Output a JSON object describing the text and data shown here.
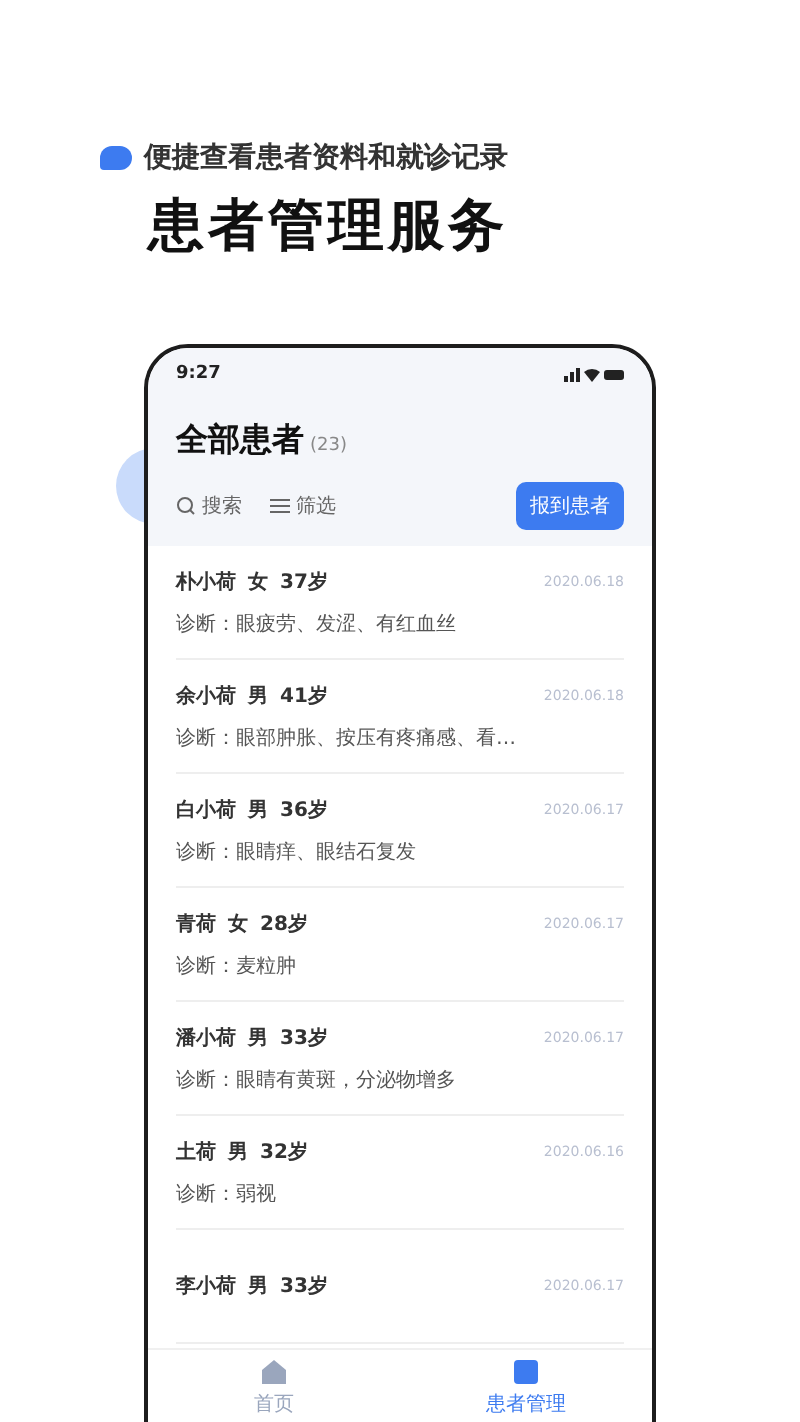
{
  "headline": {
    "subtitle": "便捷查看患者资料和就诊记录",
    "title": "患者管理服务"
  },
  "phone": {
    "status_bar": {
      "time": "9:27"
    },
    "header": {
      "title": "全部患者",
      "count": "(23)",
      "search": "搜索",
      "filter": "筛选",
      "button": "报到患者"
    },
    "patients": [
      {
        "name": "朴小荷",
        "gender": "女",
        "age": "37岁",
        "date": "2020.06.18",
        "diagnosis": "诊断：眼疲劳、发涩、有红血丝"
      },
      {
        "name": "余小荷",
        "gender": "男",
        "age": "41岁",
        "date": "2020.06.18",
        "diagnosis": "诊断：眼部肿胀、按压有疼痛感、看…"
      },
      {
        "name": "白小荷",
        "gender": "男",
        "age": "36岁",
        "date": "2020.06.17",
        "diagnosis": "诊断：眼睛痒、眼结石复发"
      },
      {
        "name": "青荷",
        "gender": "女",
        "age": "28岁",
        "date": "2020.06.17",
        "diagnosis": "诊断：麦粒肿"
      },
      {
        "name": "潘小荷",
        "gender": "男",
        "age": "33岁",
        "date": "2020.06.17",
        "diagnosis": "诊断：眼睛有黄斑，分泌物增多"
      },
      {
        "name": "土荷",
        "gender": "男",
        "age": "32岁",
        "date": "2020.06.16",
        "diagnosis": "诊断：弱视"
      },
      {
        "name": "李小荷",
        "gender": "男",
        "age": "33岁",
        "date": "2020.06.17"
      }
    ],
    "tab_bar": [
      {
        "label": "首页",
        "kind": "home",
        "selected": false
      },
      {
        "label": "患者管理",
        "kind": "patients",
        "selected": true
      }
    ]
  }
}
